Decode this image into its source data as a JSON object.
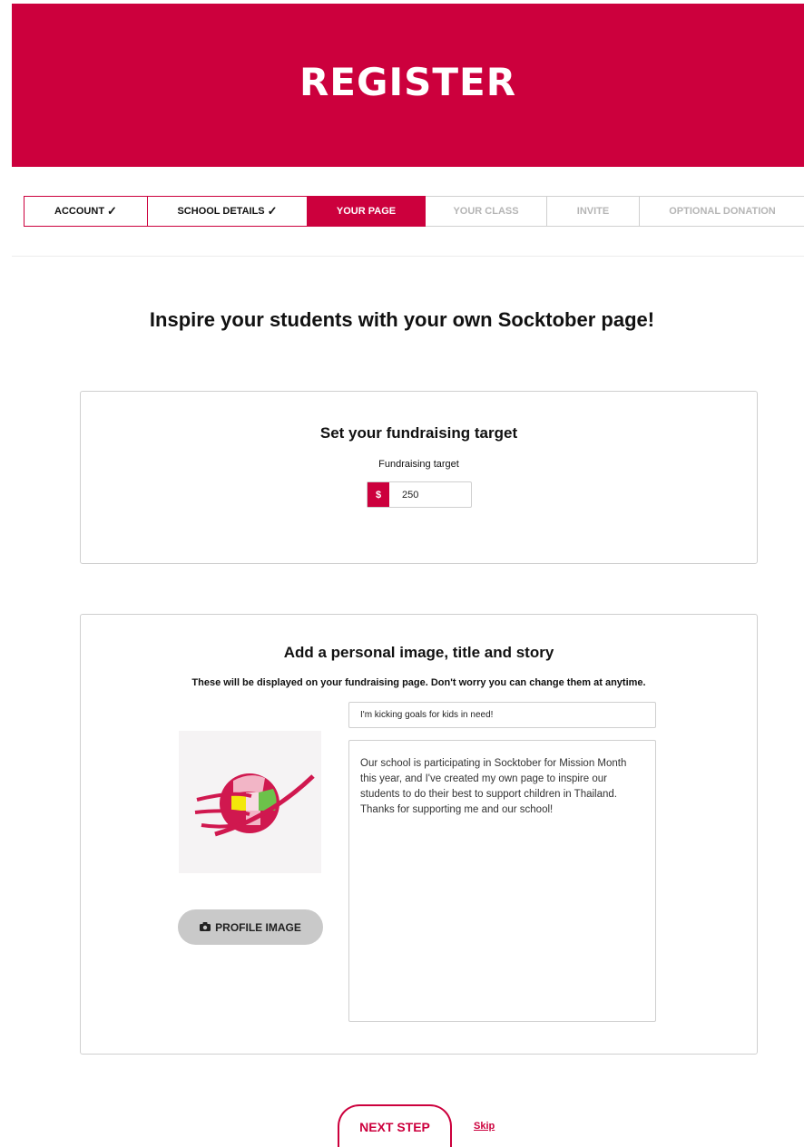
{
  "banner": {
    "title": "REGISTER"
  },
  "steps": [
    {
      "label": "ACCOUNT",
      "state": "done"
    },
    {
      "label": "SCHOOL DETAILS",
      "state": "done"
    },
    {
      "label": "YOUR PAGE",
      "state": "active"
    },
    {
      "label": "YOUR CLASS",
      "state": "todo"
    },
    {
      "label": "INVITE",
      "state": "todo"
    },
    {
      "label": "OPTIONAL DONATION",
      "state": "todo"
    }
  ],
  "heading": "Inspire your students with your own Socktober page!",
  "target_card": {
    "title": "Set your fundraising target",
    "label": "Fundraising target",
    "currency": "$",
    "value": "250"
  },
  "story_card": {
    "title": "Add a personal image, title and story",
    "subtitle": "These will be displayed on your fundraising page. Don't worry you can change them at anytime.",
    "page_title_value": "I'm kicking goals for kids in need!",
    "story_value": "Our school is participating in Socktober for Mission Month this year, and I've created my own page to inspire our students to do their best to support children in Thailand. Thanks for supporting me and our school!",
    "profile_button": "PROFILE IMAGE",
    "image_icon": "globe-logo-icon",
    "camera_icon": "camera-icon"
  },
  "footer": {
    "next_label": "NEXT STEP",
    "skip_label": "Skip"
  },
  "colors": {
    "brand": "#cc003d",
    "button_grey": "#c9c9c9"
  }
}
